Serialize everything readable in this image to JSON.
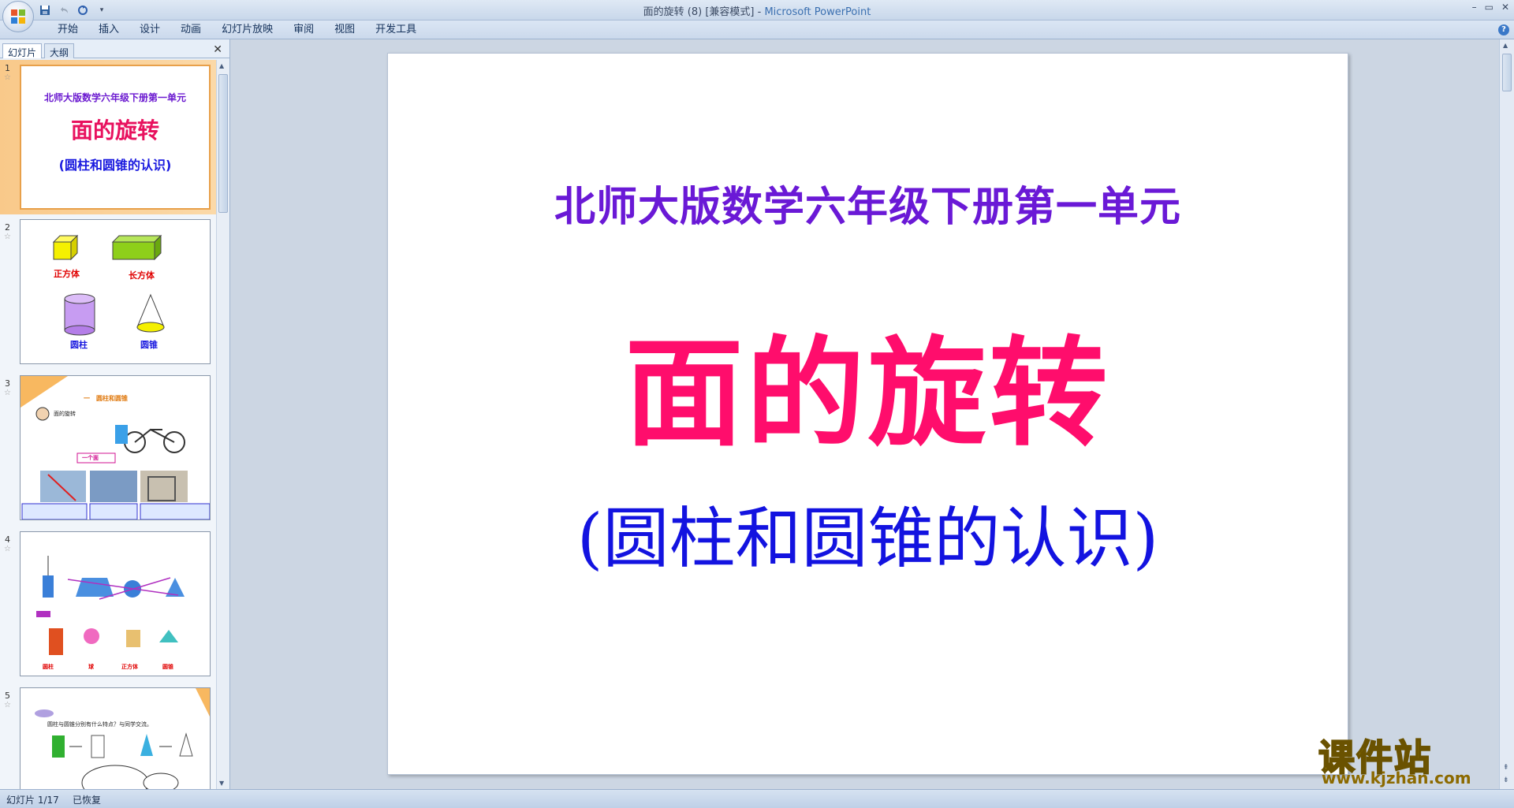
{
  "window": {
    "title": "面的旋转 (8) [兼容模式]",
    "title_sep": " - ",
    "app_name": "Microsoft PowerPoint",
    "controls": [
      "–",
      "▭",
      "✕"
    ]
  },
  "ribbon": {
    "tabs": [
      "开始",
      "插入",
      "设计",
      "动画",
      "幻灯片放映",
      "审阅",
      "视图",
      "开发工具"
    ]
  },
  "panel": {
    "tab_slides": "幻灯片",
    "tab_outline": "大纲",
    "close": "✕"
  },
  "thumbnails": {
    "slide1": {
      "num": "1",
      "subtitle": "北师大版数学六年级下册第一单元",
      "title": "面的旋转",
      "paren": "(圆柱和圆锥的认识)"
    },
    "slide2": {
      "num": "2",
      "cube": "正方体",
      "cuboid": "长方体",
      "cylinder": "圆柱",
      "cone": "圆锥"
    },
    "slide3": {
      "num": "3",
      "heading": "一　圆柱和圆锥",
      "sub": "面的旋转",
      "answer": "一个面"
    },
    "slide4": {
      "num": "4",
      "labels": [
        "圆柱",
        "球",
        "正方体",
        "圆锥"
      ]
    },
    "slide5": {
      "num": "5",
      "question": "圆柱与圆锥分别有什么特点？与同学交流。"
    }
  },
  "slide": {
    "subtitle": "北师大版数学六年级下册第一单元",
    "title": "面的旋转",
    "paren": "(圆柱和圆锥的认识)"
  },
  "watermark": {
    "text": "课件站",
    "url": "www.kjzhan.com"
  },
  "status": {
    "slide_info": "幻灯片 1/17",
    "state": "已恢复"
  },
  "colors": {
    "subtitle": "#6a19d6",
    "title": "#ff0d6c",
    "paren": "#1313e0"
  }
}
